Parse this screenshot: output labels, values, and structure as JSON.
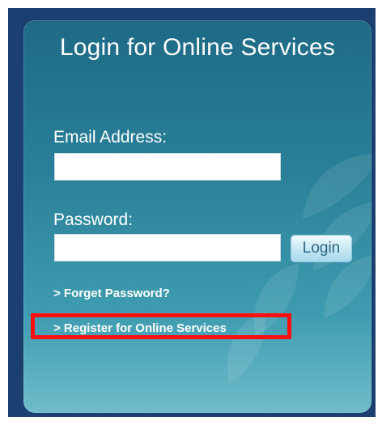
{
  "login": {
    "title": "Login for Online Services",
    "email": {
      "label": "Email Address:",
      "value": "",
      "placeholder": ""
    },
    "password": {
      "label": "Password:",
      "value": "",
      "placeholder": ""
    },
    "login_button": "Login",
    "links": {
      "forget_password": "> Forget Password?",
      "register": "> Register for Online Services"
    }
  },
  "colors": {
    "frame": "#1b3f70",
    "panel_top": "#1e6a86",
    "panel_bottom": "#6fbccb",
    "highlight": "#ff1010",
    "button_text": "#2e6a86"
  }
}
